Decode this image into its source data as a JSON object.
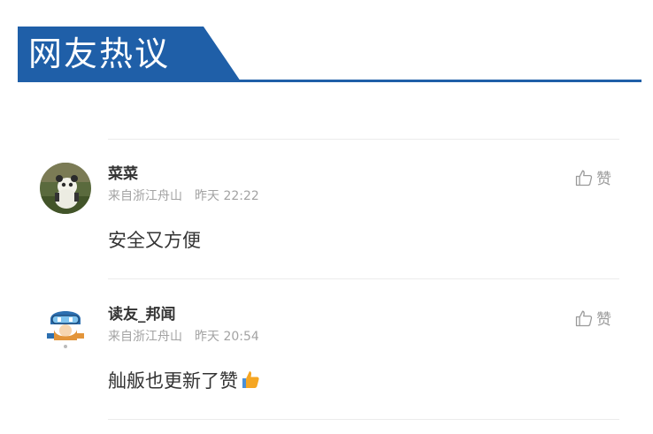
{
  "section": {
    "title": "网友热议"
  },
  "comments": [
    {
      "name": "菜菜",
      "location": "来自浙江舟山",
      "time": "昨天 22:22",
      "like_label": "赞",
      "text": "安全又方便"
    },
    {
      "name": "读友_邦闻",
      "location": "来自浙江舟山",
      "time": "昨天 20:54",
      "like_label": "赞",
      "text": "舢舨也更新了赞"
    }
  ],
  "colors": {
    "accent": "#1f5fa8",
    "name": "#333333",
    "meta": "#a3a3a3",
    "like": "#9a9a9a",
    "emoji": "#f5a623"
  },
  "icons": {
    "like": "thumbs-up-icon",
    "emoji": "thumbs-up-emoji-icon"
  }
}
